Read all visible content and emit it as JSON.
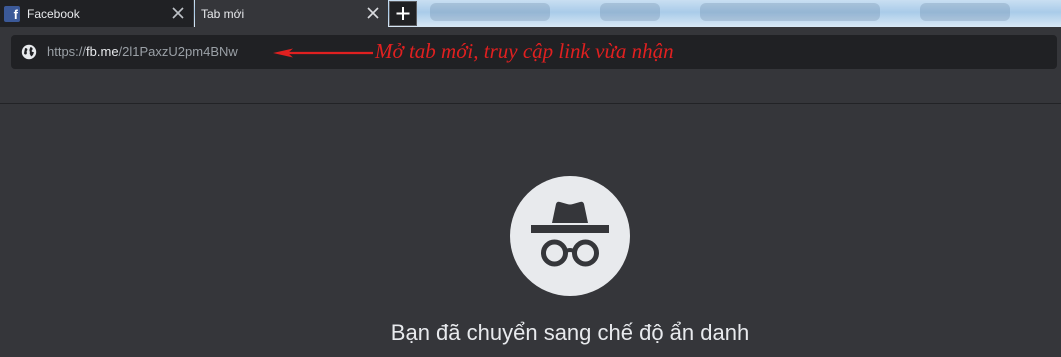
{
  "tabs": [
    {
      "title": "Facebook",
      "favicon": "facebook-icon",
      "active": false
    },
    {
      "title": "Tab mới",
      "active": true
    }
  ],
  "new_tab_icon": "plus-icon",
  "omnibox": {
    "icon": "globe-icon",
    "scheme": "https://",
    "host": "fb.me",
    "path": "/2l1PaxzU2pm4BNw"
  },
  "annotation": {
    "text": "Mở tab mới, truy cập link vừa nhận",
    "color": "#e02020"
  },
  "incognito": {
    "icon": "incognito-icon",
    "headline": "Bạn đã chuyển sang chế độ ẩn danh"
  },
  "colors": {
    "background": "#35363a",
    "omnibox": "#202124",
    "text": "#e8eaed"
  }
}
